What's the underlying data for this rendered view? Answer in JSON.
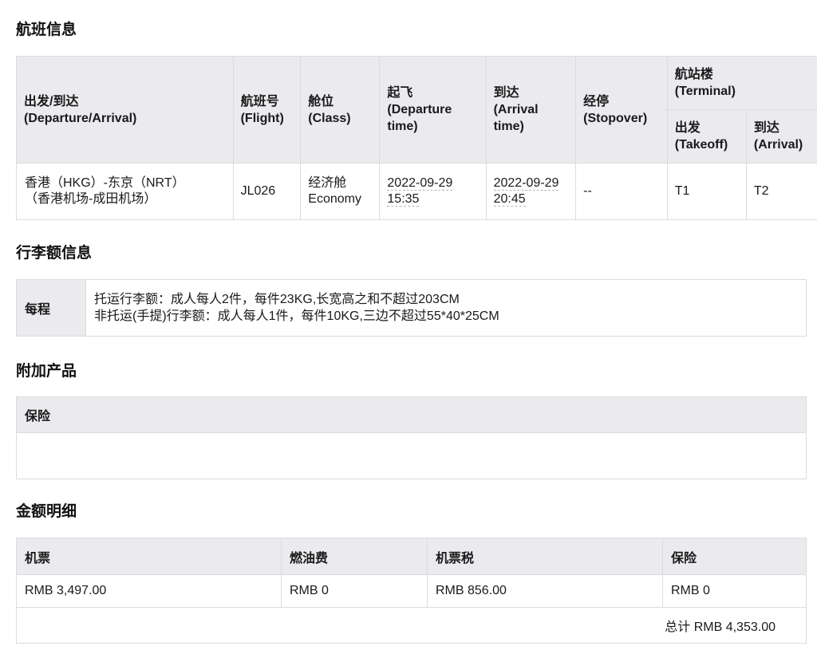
{
  "flight_section": {
    "title": "航班信息",
    "headers": {
      "route_cn": "出发/到达",
      "route_en": "(Departure/Arrival)",
      "flight_cn": "航班号",
      "flight_en": "(Flight)",
      "class_cn": "舱位",
      "class_en": "(Class)",
      "departure_cn": "起飞",
      "departure_en": "(Departure time)",
      "arrival_cn": "到达",
      "arrival_en": "(Arrival time)",
      "stopover_cn": "经停",
      "stopover_en": "(Stopover)",
      "terminal_cn": "航站楼",
      "terminal_en": "(Terminal)",
      "takeoff_cn": "出发",
      "takeoff_en": "(Takeoff)",
      "t_arrival_cn": "到达",
      "t_arrival_en": "(Arrival)"
    },
    "row": {
      "route_line1": "香港（HKG）-东京（NRT）",
      "route_line2": "（香港机场-成田机场）",
      "flight": "JL026",
      "class_cn": "经济舱",
      "class_en": "Economy",
      "departure": "2022-09-29 15:35",
      "arrival": "2022-09-29 20:45",
      "stopover": "--",
      "terminal_takeoff": "T1",
      "terminal_arrival": "T2"
    }
  },
  "baggage_section": {
    "title": "行李额信息",
    "label": "每程",
    "checked": "托运行李额：成人每人2件，每件23KG,长宽高之和不超过203CM",
    "carry_on": "非托运(手提)行李额：成人每人1件，每件10KG,三边不超过55*40*25CM"
  },
  "addon_section": {
    "title": "附加产品",
    "header": "保险",
    "value": ""
  },
  "price_section": {
    "title": "金额明细",
    "headers": [
      "机票",
      "燃油费",
      "机票税",
      "保险"
    ],
    "values": [
      "RMB 3,497.00",
      "RMB 0",
      "RMB 856.00",
      "RMB 0"
    ],
    "total": "总计 RMB 4,353.00"
  }
}
